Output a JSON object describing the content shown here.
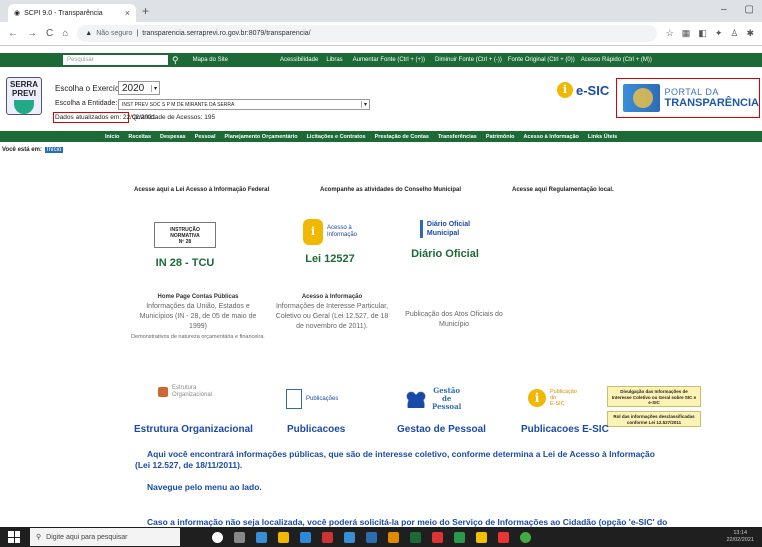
{
  "browser": {
    "tab_title": "SCPI 9.0 - Transparência",
    "url_prefix": "Não seguro",
    "url": "transparencia.serraprevi.ro.gov.br:8079/transparencia/"
  },
  "topbar": {
    "search_placeholder": "Pesquisar",
    "links": [
      "Mapa do Site",
      "Acessibilidade",
      "Libras",
      "Aumentar Fonte (Ctrl + (+))",
      "Diminuir Fonte (Ctrl + (-))",
      "Fonte Original (Ctrl + (0))",
      "Acesso Rápido (Ctrl + (M))"
    ]
  },
  "header": {
    "logo_line1": "SERRA",
    "logo_line2": "PREVI",
    "exercicio_label": "Escolha o Exercício:",
    "exercicio_value": "2020",
    "entidade_label": "Escolha a Entidade:",
    "entidade_value": "INST PREV SOC S P M DE MIRANTE DA SERRA",
    "atualizados": "Dados atualizados em: 22/02/2021",
    "acessos": "Quantidade de Acessos: 195",
    "esic": "e-SIC",
    "portal_line1": "PORTAL DA",
    "portal_line2": "TRANSPARÊNCIA"
  },
  "nav": [
    "Início",
    "Receitas",
    "Despesas",
    "Pessoal",
    "Planejamento Orçamentário",
    "Licitações e Contratos",
    "Prestação de Contas",
    "Transferências",
    "Patrimônio",
    "Acesso à Informação",
    "Links Úteis"
  ],
  "breadcrumb": {
    "label": "Você está em:",
    "current": "Início"
  },
  "content": {
    "lei_federal": "Acesse aqui a Lei Acesso à Informação Federal",
    "conselho": "Acompanhe as atividades do Conselho Municipal",
    "regulamentacao": "Acesse aqui Regulamentação local.",
    "in28_card_l1": "INSTRUÇÃO NORMATIVA",
    "in28_card_l2": "Nº 28",
    "in28_title": "IN 28 - TCU",
    "acesso_l1": "Acesso à",
    "acesso_l2": "Informação",
    "lei_title": "Lei 12527",
    "diario_l1": "Diário Oficial",
    "diario_l2": "Municipal",
    "diario_title": "Diário Oficial",
    "in28_desc_head": "Home Page Contas Públicas",
    "in28_desc": "Informações da União, Estados e Municípios (IN - 28, de 05 de maio de 1999)",
    "in28_note": "Demonstrativos de natureza orçamentária e financeira.",
    "lei_desc_head": "Acesso à Informação",
    "lei_desc": "Informações de Interesse Particular, Coletivo ou Geral (Lei 12.527, de 18 de novembro de 2011).",
    "diario_desc": "Publicação dos Atos Oficiais do Município",
    "estrutura_icon": "Estrutura Organizacional",
    "estrutura_title": "Estrutura Organizacional",
    "pub_icon": "Publicações",
    "pub_title": "Publicacoes",
    "gestao_l1": "Gestão",
    "gestao_l2": "de",
    "gestao_l3": "Pessoal",
    "gestao_title": "Gestao de Pessoal",
    "pubesic_l1": "Publicação",
    "pubesic_l2": "do",
    "pubesic_l3": "E-SIC",
    "pubesic_title": "Publicacoes E-SIC",
    "box1": "Divulgação das Informações de Interesse Coletivo ou Geral sobre SIC e e-SIC",
    "box2": "Rol das informações desclassificadas conforme Lei 12.527/2011",
    "para1": "Aqui você encontrará informações públicas, que são de interesse coletivo, conforme determina a Lei de Acesso à Informação (Lei 12.527, de 18/11/2011).",
    "para2": "Navegue pelo menu ao lado.",
    "para3": "Caso a informação não seja localizada, você poderá solicitá-la por meio do Serviço de Informações ao Cidadão (opção 'e-SIC' do"
  },
  "taskbar": {
    "search": "Digite aqui para pesquisar",
    "time": "13:14",
    "date": "22/02/2021"
  }
}
